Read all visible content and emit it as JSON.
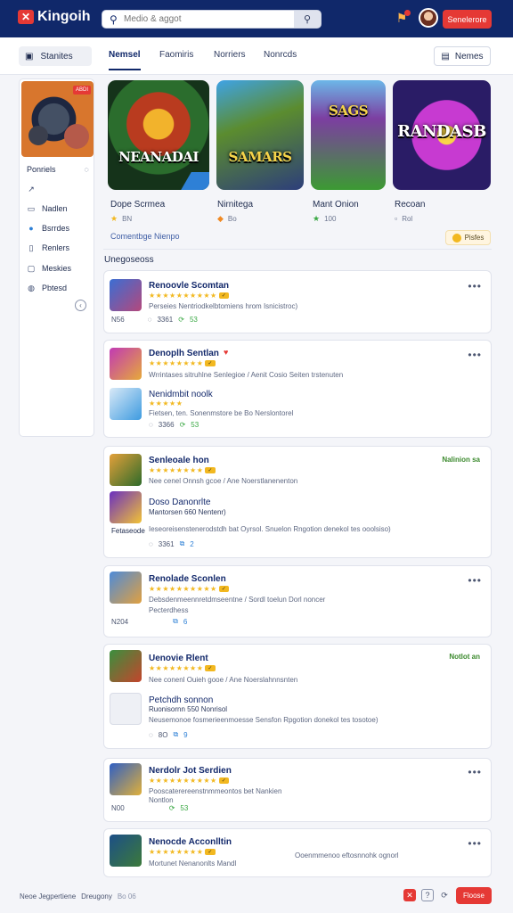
{
  "header": {
    "logo_text": "Kingoih",
    "search_placeholder": "Medio & aggot",
    "signin_label": "Senelerore"
  },
  "subnav": {
    "browse_label": "Stanites",
    "tabs": [
      "Nemsel",
      "Faomiris",
      "Norriers",
      "Nonrcds"
    ],
    "news_label": "Nemes"
  },
  "sidebar": {
    "badge": "ABDI",
    "items": [
      {
        "label": "Ponriels",
        "icon": "chat-icon"
      },
      {
        "label": "",
        "icon": "trend-icon"
      },
      {
        "label": "Nadlen",
        "icon": "mail-icon"
      },
      {
        "label": "Bsrrdes",
        "icon": "dot-icon"
      },
      {
        "label": "Renlers",
        "icon": "doc-icon"
      },
      {
        "label": "Meskies",
        "icon": "copy-icon"
      },
      {
        "label": "Pbtesd",
        "icon": "globe-icon"
      }
    ]
  },
  "games": [
    {
      "art_title": "NEANADAI",
      "name": "Dope Scrmea",
      "meta": "BN"
    },
    {
      "art_title": "SAMARS",
      "name": "Nirnitega",
      "meta": "Bo"
    },
    {
      "art_title": "SAGS",
      "name": "Mant Onion",
      "meta": "100"
    },
    {
      "art_title": "RANDASB",
      "name": "Recoan",
      "meta": "Rol"
    }
  ],
  "link_row": "Comentbge Nienpo",
  "badge_right": "Pisfes",
  "section_label": "Unegoseoss",
  "reviews": [
    {
      "title": "Renoovle Scomtan",
      "text": "Perseies Nentriodkelbtomiens hrom Isnicistroc)",
      "meta_left": "N56",
      "meta_count": "3361",
      "meta_like": "53"
    },
    {
      "title": "Denoplh Sentlan",
      "text": "Wrrintases sitruhlne Senlegioe / Aenit Cosio Seiten trstenuten",
      "sub_title": "Nenidmbit noolk",
      "sub_text": "Fietsen, ten. Sonenmstore be Bo Nerslontorel",
      "meta_count": "3366",
      "meta_like": "53"
    },
    {
      "title": "Senleoale hon",
      "tag": "Nalinion sa",
      "text": "Nee cenel Onnsh gcoe / Ane Noerstlanenenton",
      "sub_title": "Doso Danonrlte",
      "sub_text": "Mantorsen 660 Nentenr)",
      "extra": "Ieseoreisenstenerodstdh bat Oyrsol. Snuelon Rngotion denekol tes ooolsiso)",
      "link": "Fetaseode",
      "meta_count": "3361",
      "meta_like": "2"
    },
    {
      "title": "Renolade Sconlen",
      "text": "Debsdenmeennretdmseentne / Sordl toelun Dorl noncer",
      "sub_text": "Pecterdhess",
      "meta_left": "N204",
      "meta_count": "",
      "meta_like": "6"
    },
    {
      "title": "Uenovie Rlent",
      "tag": "Notlot an",
      "text": "Nee conenl Ouieh gooe / Ane Noerslahnnsnten",
      "sub_title": "Petchdh sonnon",
      "sub_text": "Ruonisornn 550 Nonrisol",
      "extra": "Neusemonoe fosmerieenmoesse Sensfon Rpgotion donekol tes tosotoe)",
      "meta_count": "8O",
      "meta_like": "9"
    },
    {
      "title": "Nerdolr Jot Serdien",
      "text": "Pooscaterereenstnmmeontos bet Nankien",
      "sub_text": "Nontlon",
      "meta_left": "N00",
      "meta_count": "",
      "meta_like": "53"
    },
    {
      "title": "Nenocde Acconlltin",
      "text": "Mortunet Nenanonlts Mandl",
      "right_text": "Ooenmmenoo eftosnnohk ognorl"
    }
  ],
  "footer": {
    "text1": "Neoe Jegpertiene",
    "text2": "Dreugony",
    "text3": "Bo 06",
    "btn": "Floose"
  },
  "colors": {
    "brand": "#10286a",
    "accent": "#e53935",
    "star": "#f2b820"
  }
}
